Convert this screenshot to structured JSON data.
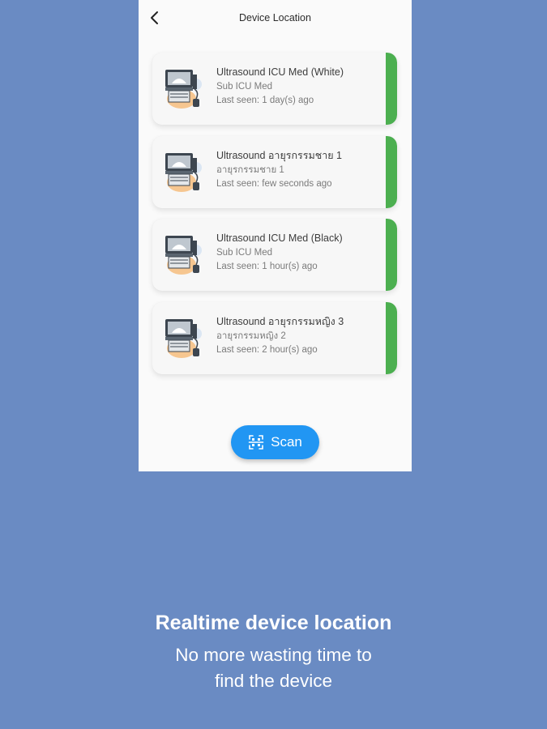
{
  "colors": {
    "background": "#6a8bc3",
    "screen": "#fafafa",
    "status_online": "#4caf50",
    "accent": "#2196f3"
  },
  "appbar": {
    "title": "Device Location",
    "back_icon": "chevron-left-icon"
  },
  "devices": [
    {
      "name": "Ultrasound ICU Med (White)",
      "location": "Sub ICU Med",
      "last_seen": "Last seen: 1 day(s) ago",
      "icon": "ultrasound-machine-icon"
    },
    {
      "name": "Ultrasound อายุรกรรมชาย 1",
      "location": "อายุรกรรมชาย 1",
      "last_seen": "Last seen: few seconds ago",
      "icon": "ultrasound-machine-icon"
    },
    {
      "name": "Ultrasound ICU Med (Black)",
      "location": "Sub ICU Med",
      "last_seen": "Last seen: 1 hour(s) ago",
      "icon": "ultrasound-machine-icon"
    },
    {
      "name": "Ultrasound อายุรกรรมหญิง 3",
      "location": "อายุรกรรมหญิง 2",
      "last_seen": "Last seen: 2 hour(s) ago",
      "icon": "ultrasound-machine-icon"
    }
  ],
  "scan_button": {
    "label": "Scan",
    "icon": "qr-scan-icon"
  },
  "promo": {
    "headline": "Realtime device location",
    "line1": "No more wasting time to",
    "line2": "find the device"
  }
}
